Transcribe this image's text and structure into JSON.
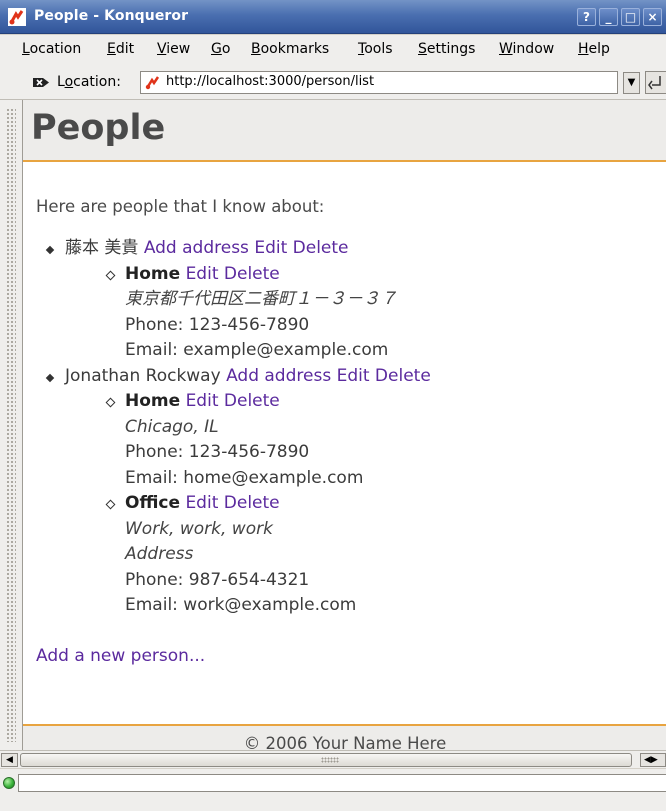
{
  "window": {
    "title": "People - Konqueror",
    "buttons": [
      "?",
      "_",
      "□",
      "×"
    ]
  },
  "menubar": [
    {
      "u": "L",
      "rest": "ocation"
    },
    {
      "u": "E",
      "rest": "dit"
    },
    {
      "u": "V",
      "rest": "iew"
    },
    {
      "u": "G",
      "rest": "o"
    },
    {
      "u": "B",
      "rest": "ookmarks"
    },
    {
      "u": "T",
      "rest": "ools"
    },
    {
      "u": "S",
      "rest": "ettings"
    },
    {
      "u": "W",
      "rest": "indow"
    },
    {
      "u": "H",
      "rest": "elp"
    }
  ],
  "location": {
    "label_prefix": "L",
    "label_u": "o",
    "label_suffix": "cation:",
    "url": "http://localhost:3000/person/list"
  },
  "page": {
    "title": "People",
    "intro": "Here are people that I know about:",
    "add_person": "Add a new person...",
    "footer": "© 2006 Your Name Here"
  },
  "people": [
    {
      "name": "藤本 美貴",
      "add_address": "Add address",
      "edit": "Edit",
      "delete": "Delete",
      "addresses": [
        {
          "type": "Home",
          "edit": "Edit",
          "delete": "Delete",
          "lines": [
            "東京都千代田区二番町１－３－３７"
          ],
          "phone": "Phone: 123-456-7890",
          "email": "Email: example@example.com"
        }
      ]
    },
    {
      "name": "Jonathan Rockway",
      "add_address": "Add address",
      "edit": "Edit",
      "delete": "Delete",
      "addresses": [
        {
          "type": "Home",
          "edit": "Edit",
          "delete": "Delete",
          "lines": [
            "Chicago, IL"
          ],
          "phone": "Phone: 123-456-7890",
          "email": "Email: home@example.com"
        },
        {
          "type": "Office",
          "edit": "Edit",
          "delete": "Delete",
          "lines": [
            "Work, work, work",
            "Address"
          ],
          "phone": "Phone: 987-654-4321",
          "email": "Email: work@example.com"
        }
      ]
    }
  ],
  "colors": {
    "titlebar": "#4a6fb0",
    "link": "#5b2a9e",
    "accent_rule": "#e8a440",
    "status_led": "#3bb33b"
  }
}
